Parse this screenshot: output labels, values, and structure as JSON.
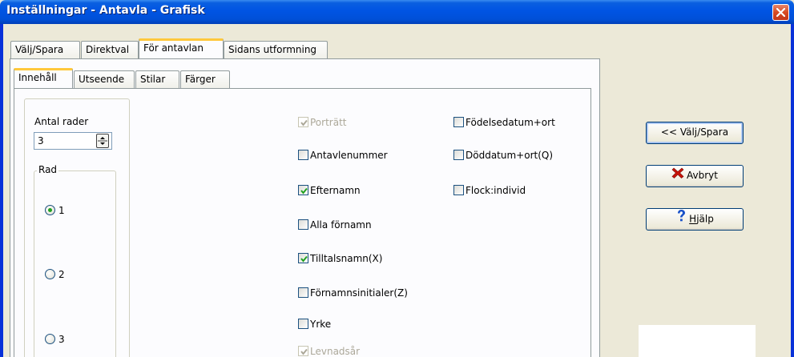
{
  "window": {
    "title": "Inställningar - Antavla - Grafisk"
  },
  "outer_tabs": [
    "Välj/Spara",
    "Direktval",
    "För antavlan",
    "Sidans utformning"
  ],
  "inner_tabs": [
    "Innehåll",
    "Utseende",
    "Stilar",
    "Färger"
  ],
  "rows": {
    "label": "Antal rader",
    "value": "3",
    "group_label": "Rad",
    "options": [
      "1",
      "2",
      "3"
    ],
    "selected": "1"
  },
  "checkboxes_col1": [
    {
      "label": "Porträtt",
      "checked": true,
      "disabled": true
    },
    {
      "label": "Antavlenummer",
      "checked": false,
      "disabled": false
    },
    {
      "label": "Efternamn",
      "checked": true,
      "disabled": false
    },
    {
      "label": "Alla förnamn",
      "checked": false,
      "disabled": false
    },
    {
      "label": "Tilltalsnamn(X)",
      "checked": true,
      "disabled": false
    },
    {
      "label": "Förnamnsinitialer(Z)",
      "checked": false,
      "disabled": false
    },
    {
      "label": "Yrke",
      "checked": false,
      "disabled": false
    },
    {
      "label": "Levnadsår",
      "checked": true,
      "disabled": true
    }
  ],
  "checkboxes_col2": [
    {
      "label": "Födelsedatum+ort",
      "checked": false
    },
    {
      "label": "Döddatum+ort(Q)",
      "checked": false
    },
    {
      "label": "Flock:individ",
      "checked": false
    }
  ],
  "buttons": {
    "save": "<< Välj/Spara",
    "cancel": "Avbryt",
    "help": "Hjälp"
  },
  "colors": {
    "titlebar": "#0054e3",
    "check": "#21a121",
    "cancel_icon": "#c8140a",
    "help_icon": "#1750c8",
    "active_tab_accent": "#ffc83c"
  }
}
